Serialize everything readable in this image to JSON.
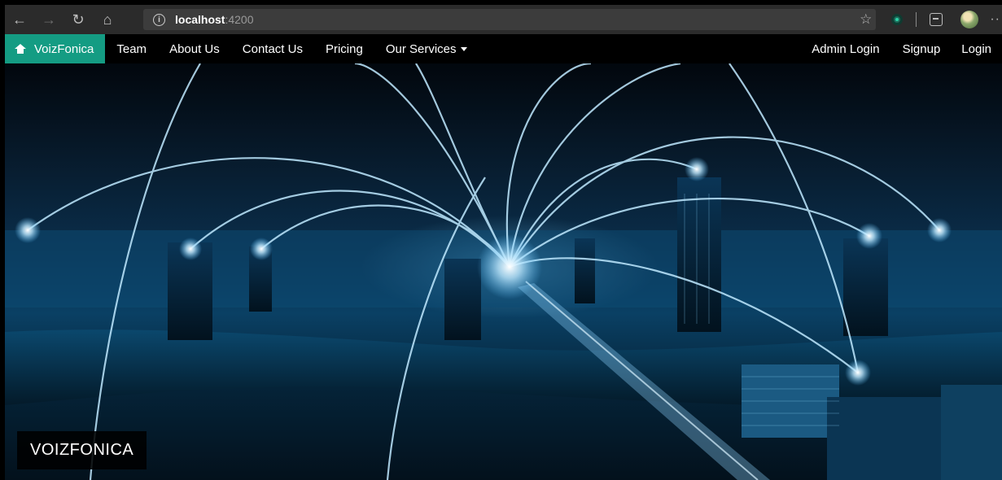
{
  "browser": {
    "back_icon": "arrow-left-icon",
    "forward_icon": "arrow-right-icon",
    "refresh_icon": "refresh-icon",
    "home_icon": "home-icon",
    "url_host": "localhost",
    "url_port": ":4200",
    "favorite_icon": "star-icon",
    "more_icon": "more-icon"
  },
  "navbar": {
    "brand": "VoizFonica",
    "links": [
      "Team",
      "About Us",
      "Contact Us",
      "Pricing"
    ],
    "services": "Our Services",
    "right_links": [
      "Admin Login",
      "Signup",
      "Login"
    ],
    "accent_color": "#149c83"
  },
  "hero": {
    "caption": "VOIZFONICA",
    "image_description_icon": "city-network-image"
  }
}
